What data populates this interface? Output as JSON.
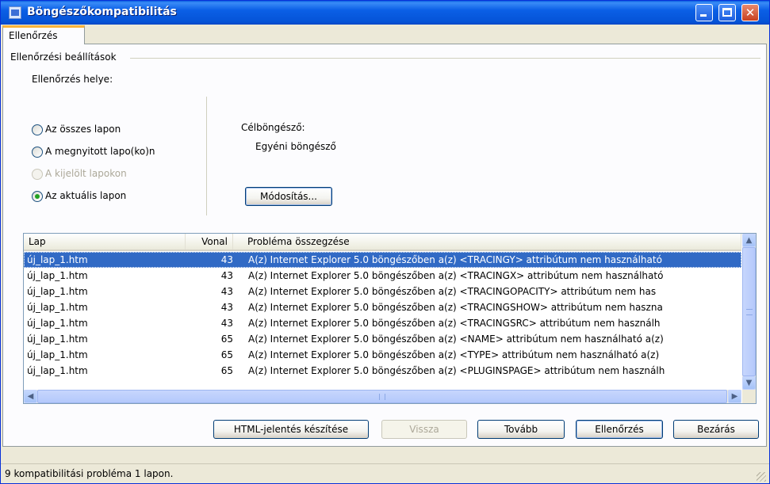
{
  "window": {
    "title": "Böngészőkompatibilitás"
  },
  "tab": {
    "label": "Ellenőrzés"
  },
  "settings": {
    "group_label": "Ellenőrzési beállítások",
    "location_label": "Ellenőrzés helye:",
    "options": [
      {
        "label": "Az összes lapon",
        "checked": false,
        "disabled": false
      },
      {
        "label": "A megnyitott lapo(ko)n",
        "checked": false,
        "disabled": false
      },
      {
        "label": "A kijelölt lapokon",
        "checked": false,
        "disabled": true
      },
      {
        "label": "Az aktuális lapon",
        "checked": true,
        "disabled": false
      }
    ],
    "target_label": "Célböngésző:",
    "target_value": "Egyéni böngésző",
    "modify_button": "Módosítás..."
  },
  "results": {
    "columns": [
      "Lap",
      "Vonal",
      "Probléma összegzése"
    ],
    "rows": [
      {
        "lap": "új_lap_1.htm",
        "vonal": "43",
        "problem": "A(z) Internet Explorer 5.0 böngészőben a(z) <TRACINGY> attribútum nem használható",
        "selected": true
      },
      {
        "lap": "új_lap_1.htm",
        "vonal": "43",
        "problem": "A(z) Internet Explorer 5.0 böngészőben a(z) <TRACINGX> attribútum nem használható",
        "selected": false
      },
      {
        "lap": "új_lap_1.htm",
        "vonal": "43",
        "problem": "A(z) Internet Explorer 5.0 böngészőben a(z) <TRACINGOPACITY> attribútum nem has",
        "selected": false
      },
      {
        "lap": "új_lap_1.htm",
        "vonal": "43",
        "problem": "A(z) Internet Explorer 5.0 böngészőben a(z) <TRACINGSHOW> attribútum nem haszna",
        "selected": false
      },
      {
        "lap": "új_lap_1.htm",
        "vonal": "43",
        "problem": "A(z) Internet Explorer 5.0 böngészőben a(z) <TRACINGSRC> attribútum nem használh",
        "selected": false
      },
      {
        "lap": "új_lap_1.htm",
        "vonal": "65",
        "problem": "A(z) Internet Explorer 5.0 böngészőben a(z) <NAME> attribútum nem használható a(z)",
        "selected": false
      },
      {
        "lap": "új_lap_1.htm",
        "vonal": "65",
        "problem": "A(z) Internet Explorer 5.0 böngészőben a(z) <TYPE> attribútum nem használható a(z)",
        "selected": false
      },
      {
        "lap": "új_lap_1.htm",
        "vonal": "65",
        "problem": "A(z) Internet Explorer 5.0 böngészőben a(z) <PLUGINSPAGE> attribútum nem használh",
        "selected": false
      }
    ]
  },
  "buttons": {
    "report": "HTML-jelentés készítése",
    "back": "Vissza",
    "next": "Tovább",
    "check": "Ellenőrzés",
    "close": "Bezárás"
  },
  "status": {
    "text": "9 kompatibilitási probléma 1 lapon."
  }
}
